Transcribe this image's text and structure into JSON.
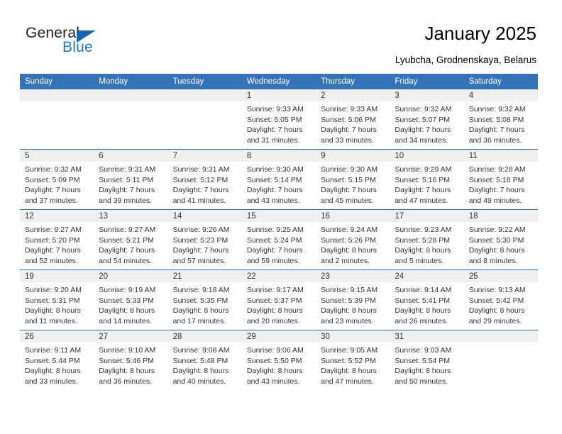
{
  "brand": {
    "name_part1": "General",
    "name_part2": "Blue",
    "triangle_icon": "triangle-icon"
  },
  "header": {
    "title": "January 2025",
    "subtitle": "Lyubcha, Grodnenskaya, Belarus"
  },
  "colors": {
    "header_blue": "#3573b9",
    "row_rule_blue": "#2f6fb5",
    "daynum_band": "#efefef",
    "logo_blue": "#1a7ac4",
    "text": "#333333"
  },
  "weekdays": [
    "Sunday",
    "Monday",
    "Tuesday",
    "Wednesday",
    "Thursday",
    "Friday",
    "Saturday"
  ],
  "weeks": [
    [
      {
        "day": "",
        "lines": []
      },
      {
        "day": "",
        "lines": []
      },
      {
        "day": "",
        "lines": []
      },
      {
        "day": "1",
        "lines": [
          "Sunrise: 9:33 AM",
          "Sunset: 5:05 PM",
          "Daylight: 7 hours",
          "and 31 minutes."
        ]
      },
      {
        "day": "2",
        "lines": [
          "Sunrise: 9:33 AM",
          "Sunset: 5:06 PM",
          "Daylight: 7 hours",
          "and 33 minutes."
        ]
      },
      {
        "day": "3",
        "lines": [
          "Sunrise: 9:32 AM",
          "Sunset: 5:07 PM",
          "Daylight: 7 hours",
          "and 34 minutes."
        ]
      },
      {
        "day": "4",
        "lines": [
          "Sunrise: 9:32 AM",
          "Sunset: 5:08 PM",
          "Daylight: 7 hours",
          "and 36 minutes."
        ]
      }
    ],
    [
      {
        "day": "5",
        "lines": [
          "Sunrise: 9:32 AM",
          "Sunset: 5:09 PM",
          "Daylight: 7 hours",
          "and 37 minutes."
        ]
      },
      {
        "day": "6",
        "lines": [
          "Sunrise: 9:31 AM",
          "Sunset: 5:11 PM",
          "Daylight: 7 hours",
          "and 39 minutes."
        ]
      },
      {
        "day": "7",
        "lines": [
          "Sunrise: 9:31 AM",
          "Sunset: 5:12 PM",
          "Daylight: 7 hours",
          "and 41 minutes."
        ]
      },
      {
        "day": "8",
        "lines": [
          "Sunrise: 9:30 AM",
          "Sunset: 5:14 PM",
          "Daylight: 7 hours",
          "and 43 minutes."
        ]
      },
      {
        "day": "9",
        "lines": [
          "Sunrise: 9:30 AM",
          "Sunset: 5:15 PM",
          "Daylight: 7 hours",
          "and 45 minutes."
        ]
      },
      {
        "day": "10",
        "lines": [
          "Sunrise: 9:29 AM",
          "Sunset: 5:16 PM",
          "Daylight: 7 hours",
          "and 47 minutes."
        ]
      },
      {
        "day": "11",
        "lines": [
          "Sunrise: 9:28 AM",
          "Sunset: 5:18 PM",
          "Daylight: 7 hours",
          "and 49 minutes."
        ]
      }
    ],
    [
      {
        "day": "12",
        "lines": [
          "Sunrise: 9:27 AM",
          "Sunset: 5:20 PM",
          "Daylight: 7 hours",
          "and 52 minutes."
        ]
      },
      {
        "day": "13",
        "lines": [
          "Sunrise: 9:27 AM",
          "Sunset: 5:21 PM",
          "Daylight: 7 hours",
          "and 54 minutes."
        ]
      },
      {
        "day": "14",
        "lines": [
          "Sunrise: 9:26 AM",
          "Sunset: 5:23 PM",
          "Daylight: 7 hours",
          "and 57 minutes."
        ]
      },
      {
        "day": "15",
        "lines": [
          "Sunrise: 9:25 AM",
          "Sunset: 5:24 PM",
          "Daylight: 7 hours",
          "and 59 minutes."
        ]
      },
      {
        "day": "16",
        "lines": [
          "Sunrise: 9:24 AM",
          "Sunset: 5:26 PM",
          "Daylight: 8 hours",
          "and 2 minutes."
        ]
      },
      {
        "day": "17",
        "lines": [
          "Sunrise: 9:23 AM",
          "Sunset: 5:28 PM",
          "Daylight: 8 hours",
          "and 5 minutes."
        ]
      },
      {
        "day": "18",
        "lines": [
          "Sunrise: 9:22 AM",
          "Sunset: 5:30 PM",
          "Daylight: 8 hours",
          "and 8 minutes."
        ]
      }
    ],
    [
      {
        "day": "19",
        "lines": [
          "Sunrise: 9:20 AM",
          "Sunset: 5:31 PM",
          "Daylight: 8 hours",
          "and 11 minutes."
        ]
      },
      {
        "day": "20",
        "lines": [
          "Sunrise: 9:19 AM",
          "Sunset: 5:33 PM",
          "Daylight: 8 hours",
          "and 14 minutes."
        ]
      },
      {
        "day": "21",
        "lines": [
          "Sunrise: 9:18 AM",
          "Sunset: 5:35 PM",
          "Daylight: 8 hours",
          "and 17 minutes."
        ]
      },
      {
        "day": "22",
        "lines": [
          "Sunrise: 9:17 AM",
          "Sunset: 5:37 PM",
          "Daylight: 8 hours",
          "and 20 minutes."
        ]
      },
      {
        "day": "23",
        "lines": [
          "Sunrise: 9:15 AM",
          "Sunset: 5:39 PM",
          "Daylight: 8 hours",
          "and 23 minutes."
        ]
      },
      {
        "day": "24",
        "lines": [
          "Sunrise: 9:14 AM",
          "Sunset: 5:41 PM",
          "Daylight: 8 hours",
          "and 26 minutes."
        ]
      },
      {
        "day": "25",
        "lines": [
          "Sunrise: 9:13 AM",
          "Sunset: 5:42 PM",
          "Daylight: 8 hours",
          "and 29 minutes."
        ]
      }
    ],
    [
      {
        "day": "26",
        "lines": [
          "Sunrise: 9:11 AM",
          "Sunset: 5:44 PM",
          "Daylight: 8 hours",
          "and 33 minutes."
        ]
      },
      {
        "day": "27",
        "lines": [
          "Sunrise: 9:10 AM",
          "Sunset: 5:46 PM",
          "Daylight: 8 hours",
          "and 36 minutes."
        ]
      },
      {
        "day": "28",
        "lines": [
          "Sunrise: 9:08 AM",
          "Sunset: 5:48 PM",
          "Daylight: 8 hours",
          "and 40 minutes."
        ]
      },
      {
        "day": "29",
        "lines": [
          "Sunrise: 9:06 AM",
          "Sunset: 5:50 PM",
          "Daylight: 8 hours",
          "and 43 minutes."
        ]
      },
      {
        "day": "30",
        "lines": [
          "Sunrise: 9:05 AM",
          "Sunset: 5:52 PM",
          "Daylight: 8 hours",
          "and 47 minutes."
        ]
      },
      {
        "day": "31",
        "lines": [
          "Sunrise: 9:03 AM",
          "Sunset: 5:54 PM",
          "Daylight: 8 hours",
          "and 50 minutes."
        ]
      },
      {
        "day": "",
        "lines": []
      }
    ]
  ]
}
